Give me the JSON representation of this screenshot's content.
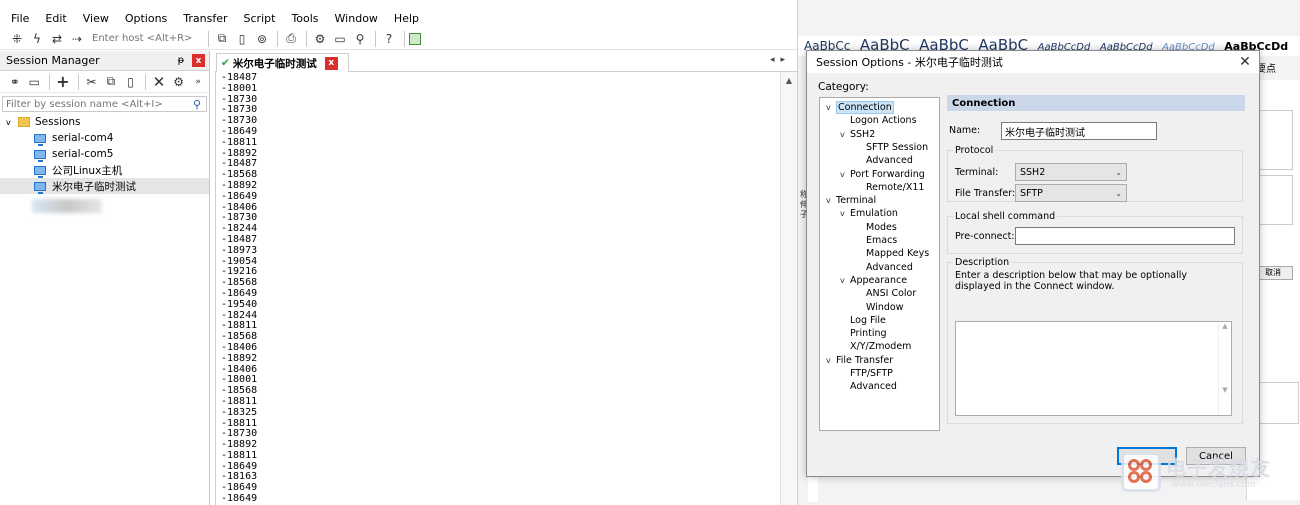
{
  "menubar": {
    "items": [
      "File",
      "Edit",
      "View",
      "Options",
      "Transfer",
      "Script",
      "Tools",
      "Window",
      "Help"
    ]
  },
  "toolbar": {
    "host_placeholder": "Enter host <Alt+R>"
  },
  "session_manager": {
    "title": "Session Manager",
    "pin": "ᵽ",
    "close": "x",
    "filter_placeholder": "Filter by session name <Alt+I>",
    "root": "Sessions",
    "items": [
      "serial-com4",
      "serial-com5",
      "公司Linux主机",
      "米尔电子临时测试"
    ]
  },
  "terminal": {
    "tab_label": "米尔电子临时测试",
    "tab_close": "x",
    "lines": [
      "-18487",
      "-18001",
      "-18730",
      "-18730",
      "-18730",
      "-18649",
      "-18811",
      "-18892",
      "-18487",
      "-18568",
      "-18892",
      "-18649",
      "-18406",
      "-18730",
      "-18244",
      "-18487",
      "-18973",
      "-19054",
      "-19216",
      "-18568",
      "-18649",
      "-19540",
      "-18244",
      "-18811",
      "-18568",
      "-18406",
      "-18892",
      "-18406",
      "-18001",
      "-18568",
      "-18811",
      "-18325",
      "-18811",
      "-18730",
      "-18892",
      "-18811",
      "-18649",
      "-18163",
      "-18649",
      "-18649"
    ]
  },
  "background_app": {
    "styles": [
      "AaBbCc",
      "AaBbC",
      "AaBbC",
      "AaBbC",
      "AaBbCcDd",
      "AaBbCcDd",
      "AaBbCcDd",
      "AaBbCcDd"
    ],
    "side_label": "要点",
    "cancel_label": "取消",
    "partial_texts": [
      "称述",
      "伸幅",
      "子在"
    ]
  },
  "dialog": {
    "title": "Session Options - 米尔电子临时测试",
    "close": "✕",
    "category_label": "Category:",
    "categories": [
      {
        "label": "Connection",
        "level": 0,
        "toggle": "v",
        "selected": true
      },
      {
        "label": "Logon Actions",
        "level": 1,
        "toggle": ""
      },
      {
        "label": "SSH2",
        "level": 1,
        "toggle": "v"
      },
      {
        "label": "SFTP Session",
        "level": 2,
        "toggle": ""
      },
      {
        "label": "Advanced",
        "level": 2,
        "toggle": ""
      },
      {
        "label": "Port Forwarding",
        "level": 1,
        "toggle": "v"
      },
      {
        "label": "Remote/X11",
        "level": 2,
        "toggle": ""
      },
      {
        "label": "Terminal",
        "level": 0,
        "toggle": "v"
      },
      {
        "label": "Emulation",
        "level": 1,
        "toggle": "v"
      },
      {
        "label": "Modes",
        "level": 2,
        "toggle": ""
      },
      {
        "label": "Emacs",
        "level": 2,
        "toggle": ""
      },
      {
        "label": "Mapped Keys",
        "level": 2,
        "toggle": ""
      },
      {
        "label": "Advanced",
        "level": 2,
        "toggle": ""
      },
      {
        "label": "Appearance",
        "level": 1,
        "toggle": "v"
      },
      {
        "label": "ANSI Color",
        "level": 2,
        "toggle": ""
      },
      {
        "label": "Window",
        "level": 2,
        "toggle": ""
      },
      {
        "label": "Log File",
        "level": 1,
        "toggle": ""
      },
      {
        "label": "Printing",
        "level": 1,
        "toggle": ""
      },
      {
        "label": "X/Y/Zmodem",
        "level": 1,
        "toggle": ""
      },
      {
        "label": "File Transfer",
        "level": 0,
        "toggle": "v"
      },
      {
        "label": "FTP/SFTP",
        "level": 1,
        "toggle": ""
      },
      {
        "label": "Advanced",
        "level": 1,
        "toggle": ""
      }
    ],
    "section_header": "Connection",
    "name_label": "Name:",
    "name_value": "米尔电子临时测试",
    "protocol_group": "Protocol",
    "terminal_label": "Terminal:",
    "terminal_value": "SSH2",
    "file_transfer_label": "File Transfer:",
    "file_transfer_value": "SFTP",
    "local_shell_group": "Local shell command",
    "pre_connect_label": "Pre-connect:",
    "pre_connect_value": "",
    "description_group": "Description",
    "description_hint": "Enter a description below that may be optionally displayed in the Connect window.",
    "description_value": "",
    "ok_label": "",
    "cancel_label": "Cancel"
  },
  "watermark": {
    "text": "电子发烧友",
    "url": "www.elecfans.com"
  }
}
